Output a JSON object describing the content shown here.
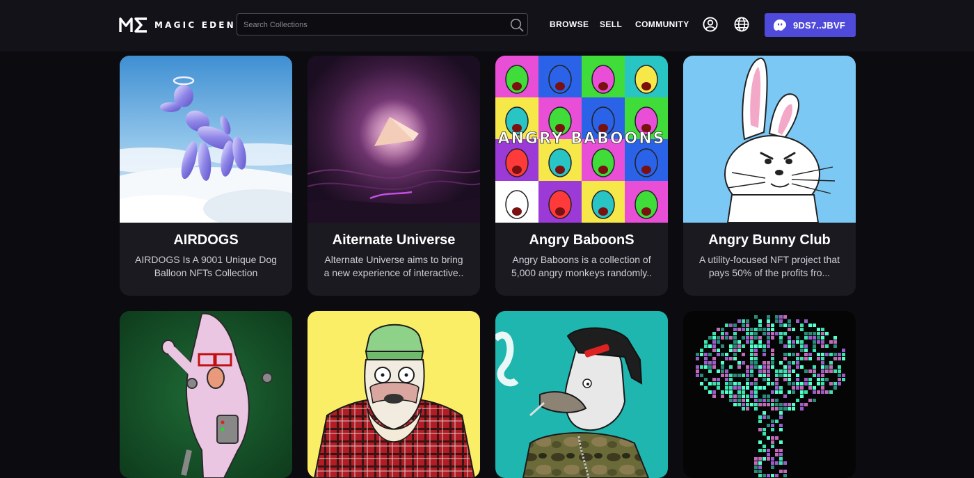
{
  "header": {
    "logo_text": "MAGIC EDEN",
    "search": {
      "placeholder": "Search Collections",
      "value": ""
    },
    "nav": [
      {
        "label": "BROWSE"
      },
      {
        "label": "SELL"
      },
      {
        "label": "COMMUNITY"
      }
    ],
    "icons": {
      "search": "search-icon",
      "profile": "user-circle-icon",
      "language": "globe-icon",
      "wallet": "ghost-wallet-icon"
    },
    "wallet_label": "9DS7..JBVF"
  },
  "collections": [
    {
      "title": "AIRDOGS",
      "description": "AIRDOGS Is A 9001 Unique Dog Balloon NFTs Collection"
    },
    {
      "title": "Aiternate Universe",
      "description": "Alternate Universe aims to bring a new experience of interactive.."
    },
    {
      "title": "Angry BaboonS",
      "description": "Angry Baboons is a collection of 5,000 angry monkeys randomly.."
    },
    {
      "title": "Angry Bunny Club",
      "description": "A utility-focused NFT project that pays 50% of the profits fro..."
    },
    {
      "title": "",
      "description": ""
    },
    {
      "title": "",
      "description": ""
    },
    {
      "title": "",
      "description": ""
    },
    {
      "title": "",
      "description": ""
    }
  ],
  "baboons_overlay_text": "ANGRY BABOONS",
  "colors": {
    "background": "#0c0b0f",
    "header": "#141219",
    "card": "#1b1a20",
    "wallet_button": "#4f4ad9"
  }
}
